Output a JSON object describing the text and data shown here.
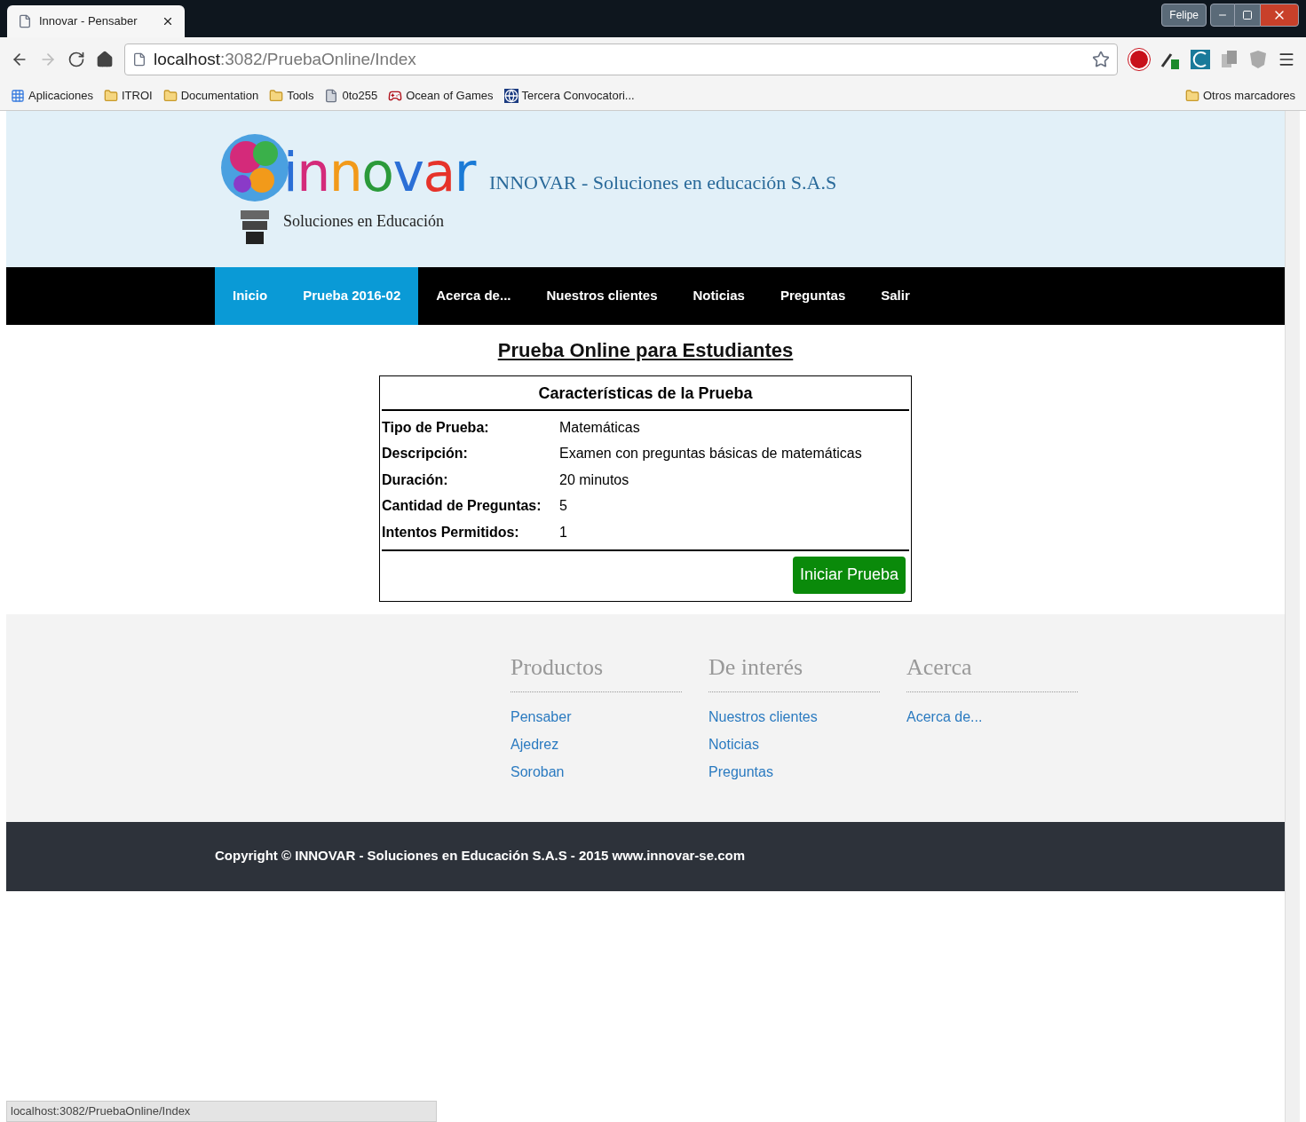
{
  "browser": {
    "tab_title": "Innovar - Pensaber",
    "profile": "Felipe",
    "url_host": "localhost",
    "url_path": ":3082/PruebaOnline/Index",
    "bookmarks": [
      {
        "label": "Aplicaciones",
        "kind": "apps"
      },
      {
        "label": "ITROI",
        "kind": "folder"
      },
      {
        "label": "Documentation",
        "kind": "folder"
      },
      {
        "label": "Tools",
        "kind": "folder"
      },
      {
        "label": "0to255",
        "kind": "page"
      },
      {
        "label": "Ocean of Games",
        "kind": "game"
      },
      {
        "label": "Tercera Convocatori...",
        "kind": "site"
      }
    ],
    "other_bookmarks": "Otros marcadores"
  },
  "header": {
    "logo_word": "innovar",
    "logo_tagline": "Soluciones en Educación",
    "title": "INNOVAR - Soluciones en educación S.A.S"
  },
  "nav": [
    {
      "label": "Inicio",
      "selected": true
    },
    {
      "label": "Prueba 2016-02",
      "selected": true
    },
    {
      "label": "Acerca de...",
      "selected": false
    },
    {
      "label": "Nuestros clientes",
      "selected": false
    },
    {
      "label": "Noticias",
      "selected": false
    },
    {
      "label": "Preguntas",
      "selected": false
    },
    {
      "label": "Salir",
      "selected": false
    }
  ],
  "page_title": "Prueba Online para Estudiantes",
  "test": {
    "heading": "Características de la Prueba",
    "rows": [
      {
        "label": "Tipo de Prueba:",
        "value": "Matemáticas"
      },
      {
        "label": "Descripción:",
        "value": "Examen con preguntas básicas de matemáticas"
      },
      {
        "label": "Duración:",
        "value": "20 minutos"
      },
      {
        "label": "Cantidad de Preguntas:",
        "value": "5"
      },
      {
        "label": "Intentos Permitidos:",
        "value": "1"
      }
    ],
    "button": "Iniciar Prueba"
  },
  "footer": {
    "columns": [
      {
        "title": "Productos",
        "links": [
          "Pensaber",
          "Ajedrez",
          "Soroban"
        ]
      },
      {
        "title": "De interés",
        "links": [
          "Nuestros clientes",
          "Noticias",
          "Preguntas"
        ]
      },
      {
        "title": "Acerca",
        "links": [
          "Acerca de..."
        ]
      }
    ],
    "copyright": "Copyright © INNOVAR - Soluciones en Educación S.A.S - 2015 www.innovar-se.com"
  },
  "status_bar": "localhost:3082/PruebaOnline/Index"
}
